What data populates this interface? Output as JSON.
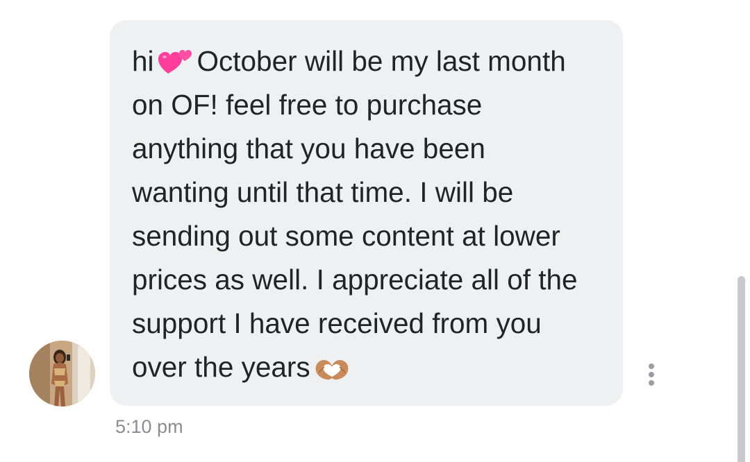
{
  "message": {
    "sender_avatar_icon": "profile-photo",
    "lines": [
      {
        "before": "hi",
        "emoji": "two-hearts-icon",
        "after": "October will be my last month"
      },
      {
        "text": "on OF! feel free to purchase"
      },
      {
        "text": "anything that you have been"
      },
      {
        "text": "wanting until that time. I will be"
      },
      {
        "text": "sending out some content at lower"
      },
      {
        "text": "prices as well. I appreciate all of the"
      },
      {
        "text": "support I have received from you"
      },
      {
        "before": "over the years",
        "emoji": "heart-hands-icon",
        "after": ""
      }
    ],
    "timestamp": "5:10 pm"
  },
  "colors": {
    "bubble_bg": "#eff0f2",
    "text": "#212326",
    "timestamp": "#8a8d92",
    "scrollbar": "#c9cacd"
  },
  "icons": {
    "more_options": "more-vertical-icon"
  }
}
